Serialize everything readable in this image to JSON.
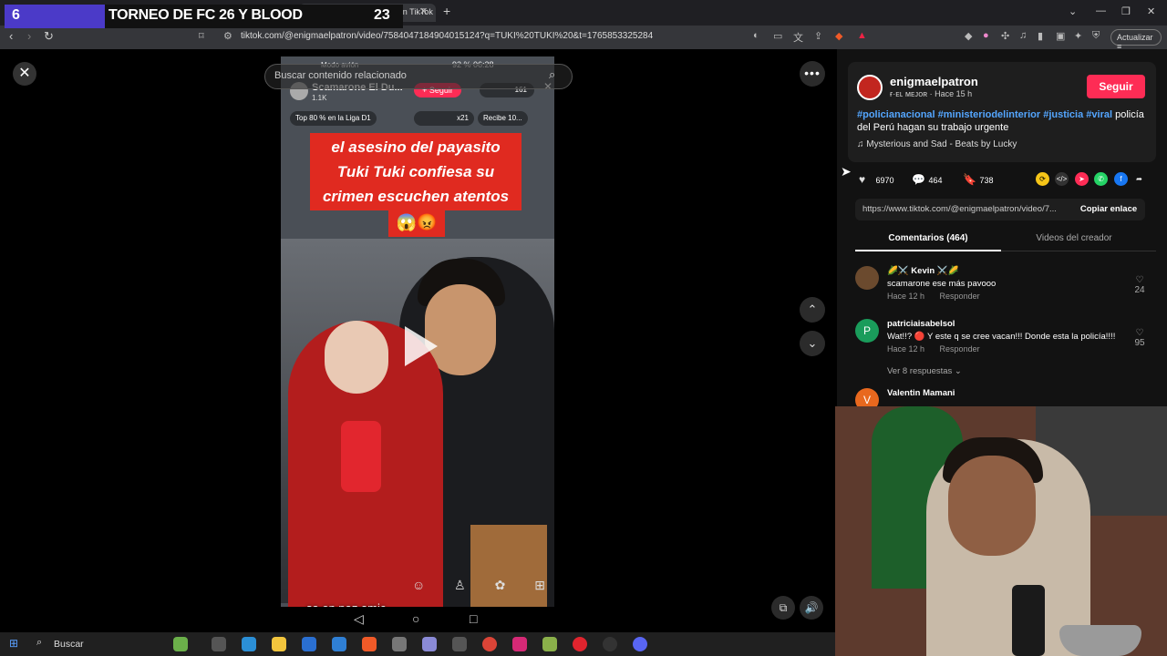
{
  "overlay": {
    "number": "6",
    "title": "TORNEO DE FC 26 Y BLOOD",
    "score": "23"
  },
  "browser": {
    "tab_title": "Encuentra 'TUKI TUKI' en TikTok",
    "url": "tiktok.com/@enigmaelpatron/video/7584047184904015124?q=TUKI%20TUKI%20&t=1765853325284",
    "update_label": "Actualizar"
  },
  "tiktok": {
    "search_placeholder": "Buscar contenido relacionado",
    "video": {
      "status_left": "Modo avión",
      "status_right": "92 %  06:28",
      "live_name": "Scamarone El Du...",
      "live_likes": "1.1K",
      "live_follow": "+ Seguir",
      "live_viewers": "161",
      "pill_top": "Top 80 % en la Liga D1",
      "pill_mult": "x21",
      "pill_gift": "Recibe 10...",
      "caption": "el asesino del payasito Tuki Tuki confiesa su crimen escuchen atentos",
      "caption_emoji": "😱😡",
      "subtitle": "sa en paz amic"
    },
    "author": {
      "name": "enigmaelpatron",
      "sub": "ғ·ᴇʟ ᴍᴇᴊᴏʀ · Hace 15 h",
      "follow_label": "Seguir",
      "hashtags": [
        "#policianacional",
        "#ministeriodelinterior",
        "#justicia",
        "#viral"
      ],
      "description": "policía del Perú hagan su trabajo urgente",
      "music": "Mysterious and Sad - Beats by Lucky"
    },
    "stats": {
      "likes": "6970",
      "comments": "464",
      "saves": "738"
    },
    "share": {
      "link": "https://www.tiktok.com/@enigmaelpatron/video/7...",
      "copy_label": "Copiar enlace"
    },
    "tabs": {
      "comments": "Comentarios (464)",
      "creator_videos": "Videos del creador"
    },
    "comments": [
      {
        "user": "🌽⚔️ Kevin ⚔️🌽",
        "text": "scamarone ese más pavooo",
        "time": "Hace 12 h",
        "reply": "Responder",
        "likes": "24",
        "avatar": "",
        "avatar_color": "#6b4a2e"
      },
      {
        "user": "patriciaisabelsol",
        "text": "Wat!!? 🔴 Y este q se cree vacan!!! Donde esta la policía!!!!",
        "time": "Hace 12 h",
        "reply": "Responder",
        "likes": "95",
        "avatar": "P",
        "avatar_color": "#1a9c5b"
      },
      {
        "user": "Valentin Mamani",
        "text": "",
        "time": "",
        "reply": "",
        "likes": "",
        "avatar": "V",
        "avatar_color": "#e8681e"
      }
    ],
    "view_replies": "Ver 8 respuestas"
  },
  "taskbar": {
    "search_label": "Buscar"
  },
  "colors": {
    "accent": "#fe2c55",
    "hashtag": "#54a6ff",
    "caption_bg": "#e02a20",
    "overlay_purple": "#4b3ac8"
  }
}
